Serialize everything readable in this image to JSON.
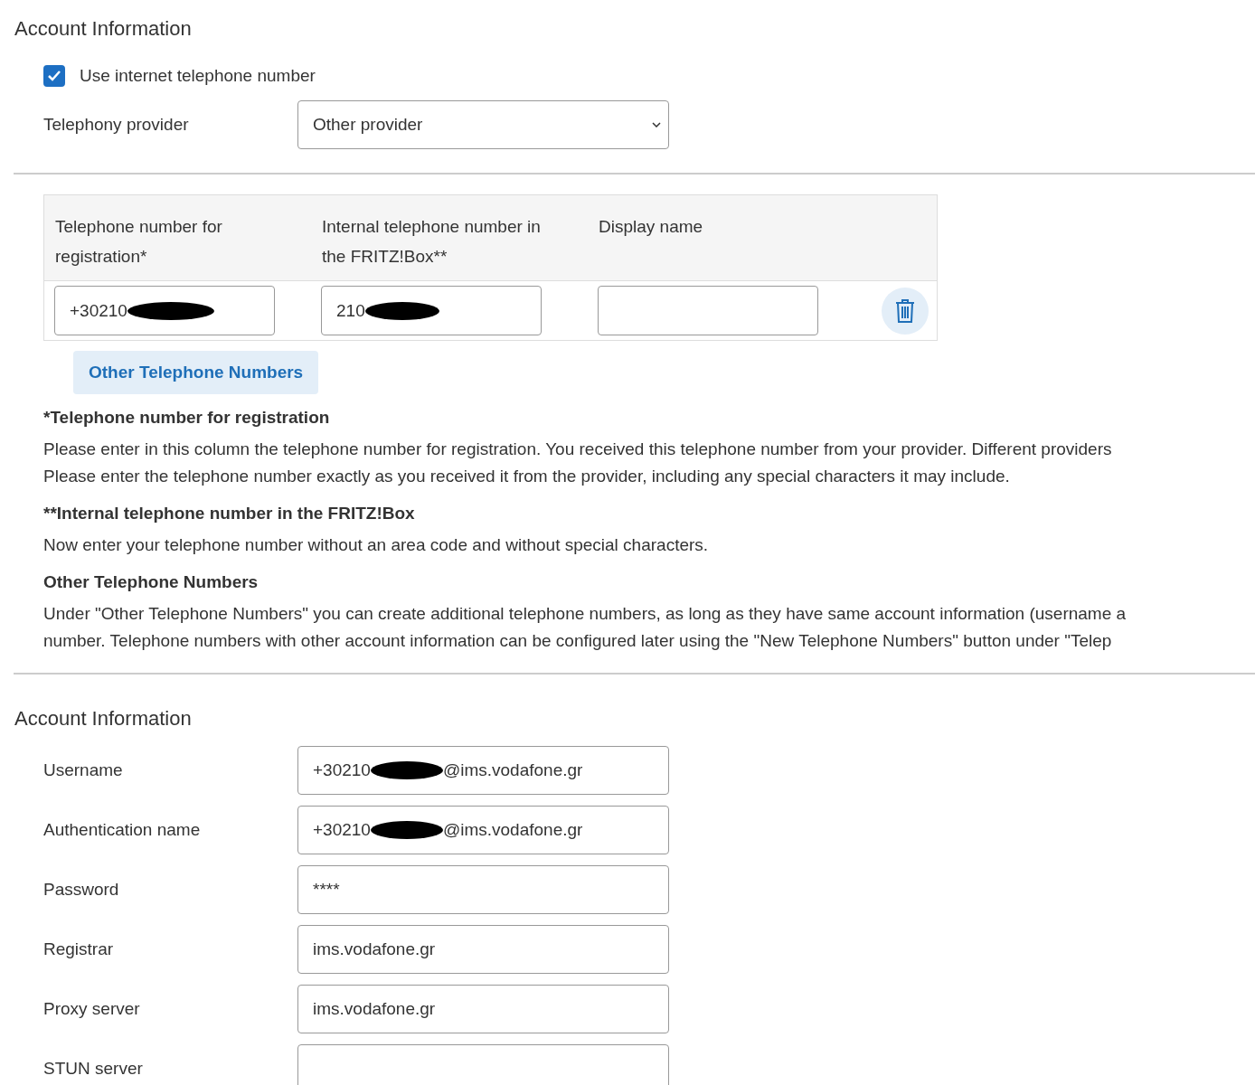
{
  "section_1": {
    "title": "Account Information",
    "use_internet_number": {
      "label": "Use internet telephone number",
      "checked": true
    },
    "provider": {
      "label": "Telephony provider",
      "value": "Other provider"
    }
  },
  "numbers_table": {
    "columns": [
      "Telephone number for registration*",
      "Internal telephone number in the FRITZ!Box**",
      "Display name"
    ],
    "rows": [
      {
        "cells": [
          {
            "value_start": "+30210",
            "redacted": true
          },
          {
            "value_start": "210",
            "redacted": true
          },
          {
            "redacted": false
          }
        ]
      }
    ]
  },
  "other_numbers_button": "Other Telephone Numbers",
  "notes": [
    {
      "heading": "*Telephone number for registration",
      "lines": [
        "Please enter in this column the telephone number for registration. You received this telephone number from your provider. Different providers",
        "Please enter the telephone number exactly as you received it from the provider, including any special characters it may include."
      ]
    },
    {
      "heading": "**Internal telephone number in the FRITZ!Box",
      "lines": [
        "Now enter your telephone number without an area code and without special characters."
      ]
    },
    {
      "heading": "Other Telephone Numbers",
      "lines": [
        "Under \"Other Telephone Numbers\" you can create additional telephone numbers, as long as they have same account information (username a",
        "number. Telephone numbers with other account information can be configured later using the \"New Telephone Numbers\" button under \"Telep"
      ]
    }
  ],
  "section_2": {
    "title": "Account Information",
    "fields": [
      {
        "label": "Username",
        "value_start": "+30210",
        "redacted": true,
        "value_end": "@ims.vodafone.gr"
      },
      {
        "label": "Authentication name",
        "value_start": "+30210",
        "redacted": true,
        "value_end": "@ims.vodafone.gr"
      },
      {
        "label": "Password",
        "value_start": "****",
        "redacted": false
      },
      {
        "label": "Registrar",
        "value_start": "ims.vodafone.gr",
        "redacted": false
      },
      {
        "label": "Proxy server",
        "value_start": "ims.vodafone.gr",
        "redacted": false
      },
      {
        "label": "STUN server",
        "redacted": false
      }
    ]
  }
}
